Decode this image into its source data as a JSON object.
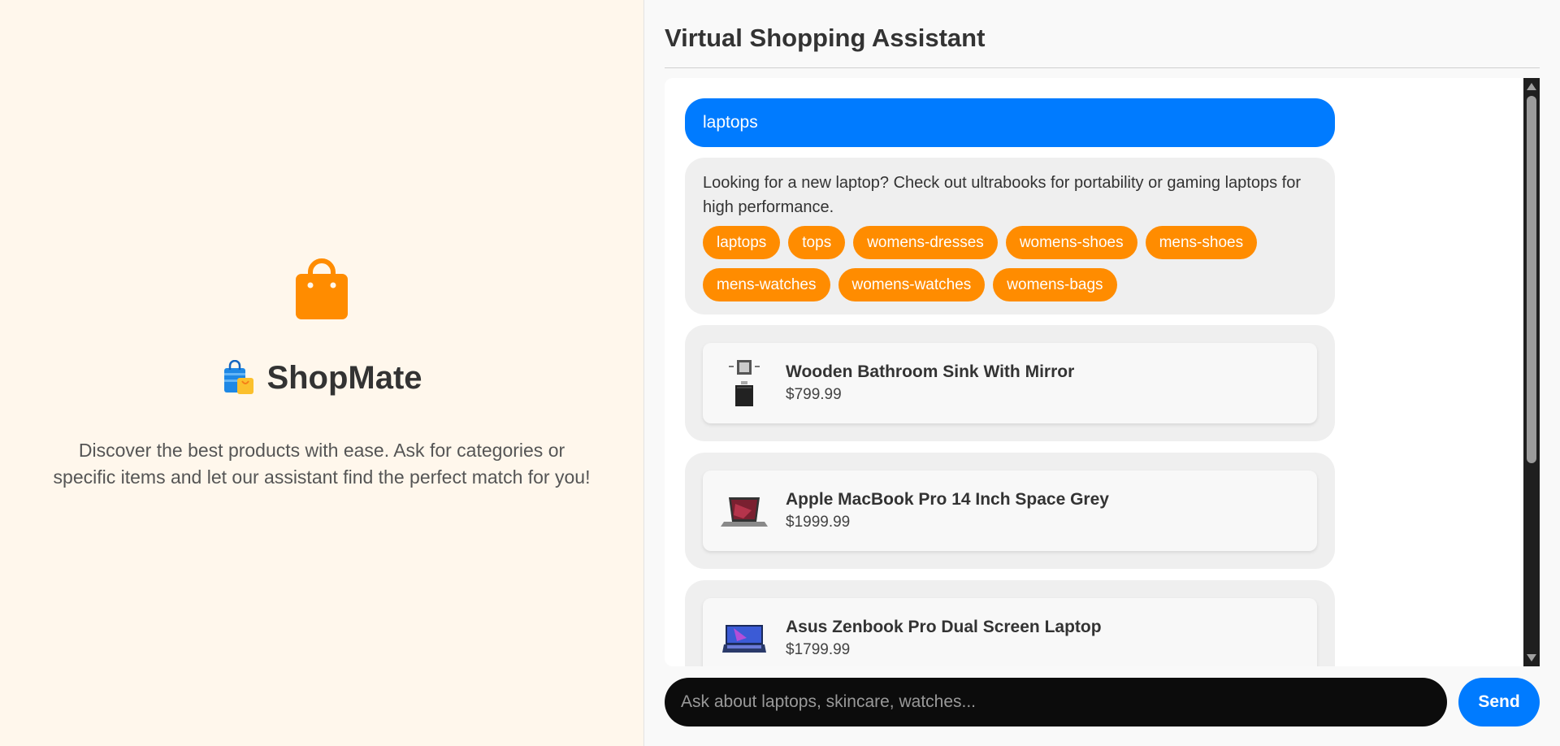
{
  "sidebar": {
    "logo_icon": "shopping-bag-icon",
    "brand_emoji": "shopping-bags-icon",
    "brand_name": "ShopMate",
    "tagline": "Discover the best products with ease. Ask for categories or specific items and let our assistant find the perfect match for you!"
  },
  "chat": {
    "title": "Virtual Shopping Assistant",
    "user_message": "laptops",
    "bot_message": "Looking for a new laptop? Check out ultrabooks for portability or gaming laptops for high performance.",
    "categories": [
      "laptops",
      "tops",
      "womens-dresses",
      "womens-shoes",
      "mens-shoes",
      "mens-watches",
      "womens-watches",
      "womens-bags"
    ],
    "products": [
      {
        "name": "Wooden Bathroom Sink With Mirror",
        "price": "$799.99",
        "image": "bathroom-sink-thumbnail"
      },
      {
        "name": "Apple MacBook Pro 14 Inch Space Grey",
        "price": "$1999.99",
        "image": "macbook-thumbnail"
      },
      {
        "name": "Asus Zenbook Pro Dual Screen Laptop",
        "price": "$1799.99",
        "image": "zenbook-thumbnail"
      }
    ]
  },
  "input": {
    "placeholder": "Ask about laptops, skincare, watches...",
    "value": "",
    "send_label": "Send"
  },
  "colors": {
    "accent": "#007bff",
    "chip": "#ff8c00",
    "left_bg": "#fff7ec"
  }
}
